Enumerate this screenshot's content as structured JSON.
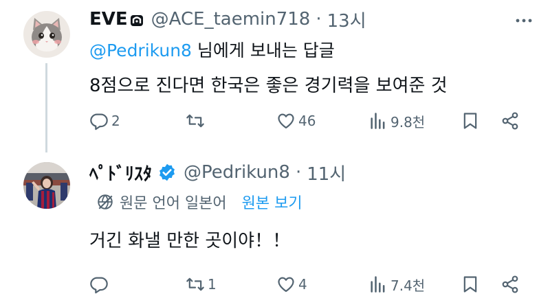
{
  "tweets": [
    {
      "display_name": "EVE",
      "handle": "@ACE_taemin718",
      "separator": "·",
      "time": "13시",
      "reply_to": {
        "mention": "@Pedrikun8",
        "suffix": " 님에게 보내는 답글"
      },
      "text": "8점으로 진다면 한국은 좋은 경기력을 보여준 것",
      "actions": {
        "replies": "2",
        "retweets": "",
        "likes": "46",
        "views": "9.8천"
      }
    },
    {
      "display_name": "ﾍﾟﾄﾞﾘｽﾀ",
      "handle": "@Pedrikun8",
      "separator": "·",
      "time": "11시",
      "translation": {
        "label": "원문 언어 일본어",
        "link": "원본 보기"
      },
      "text": "거긴 화낼 만한 곳이야！！",
      "actions": {
        "replies": "",
        "retweets": "1",
        "likes": "4",
        "views": "7.4천"
      }
    }
  ],
  "colors": {
    "accent": "#1d9bf0",
    "secondary_text": "#536471",
    "thread_line": "#cfd9de"
  }
}
